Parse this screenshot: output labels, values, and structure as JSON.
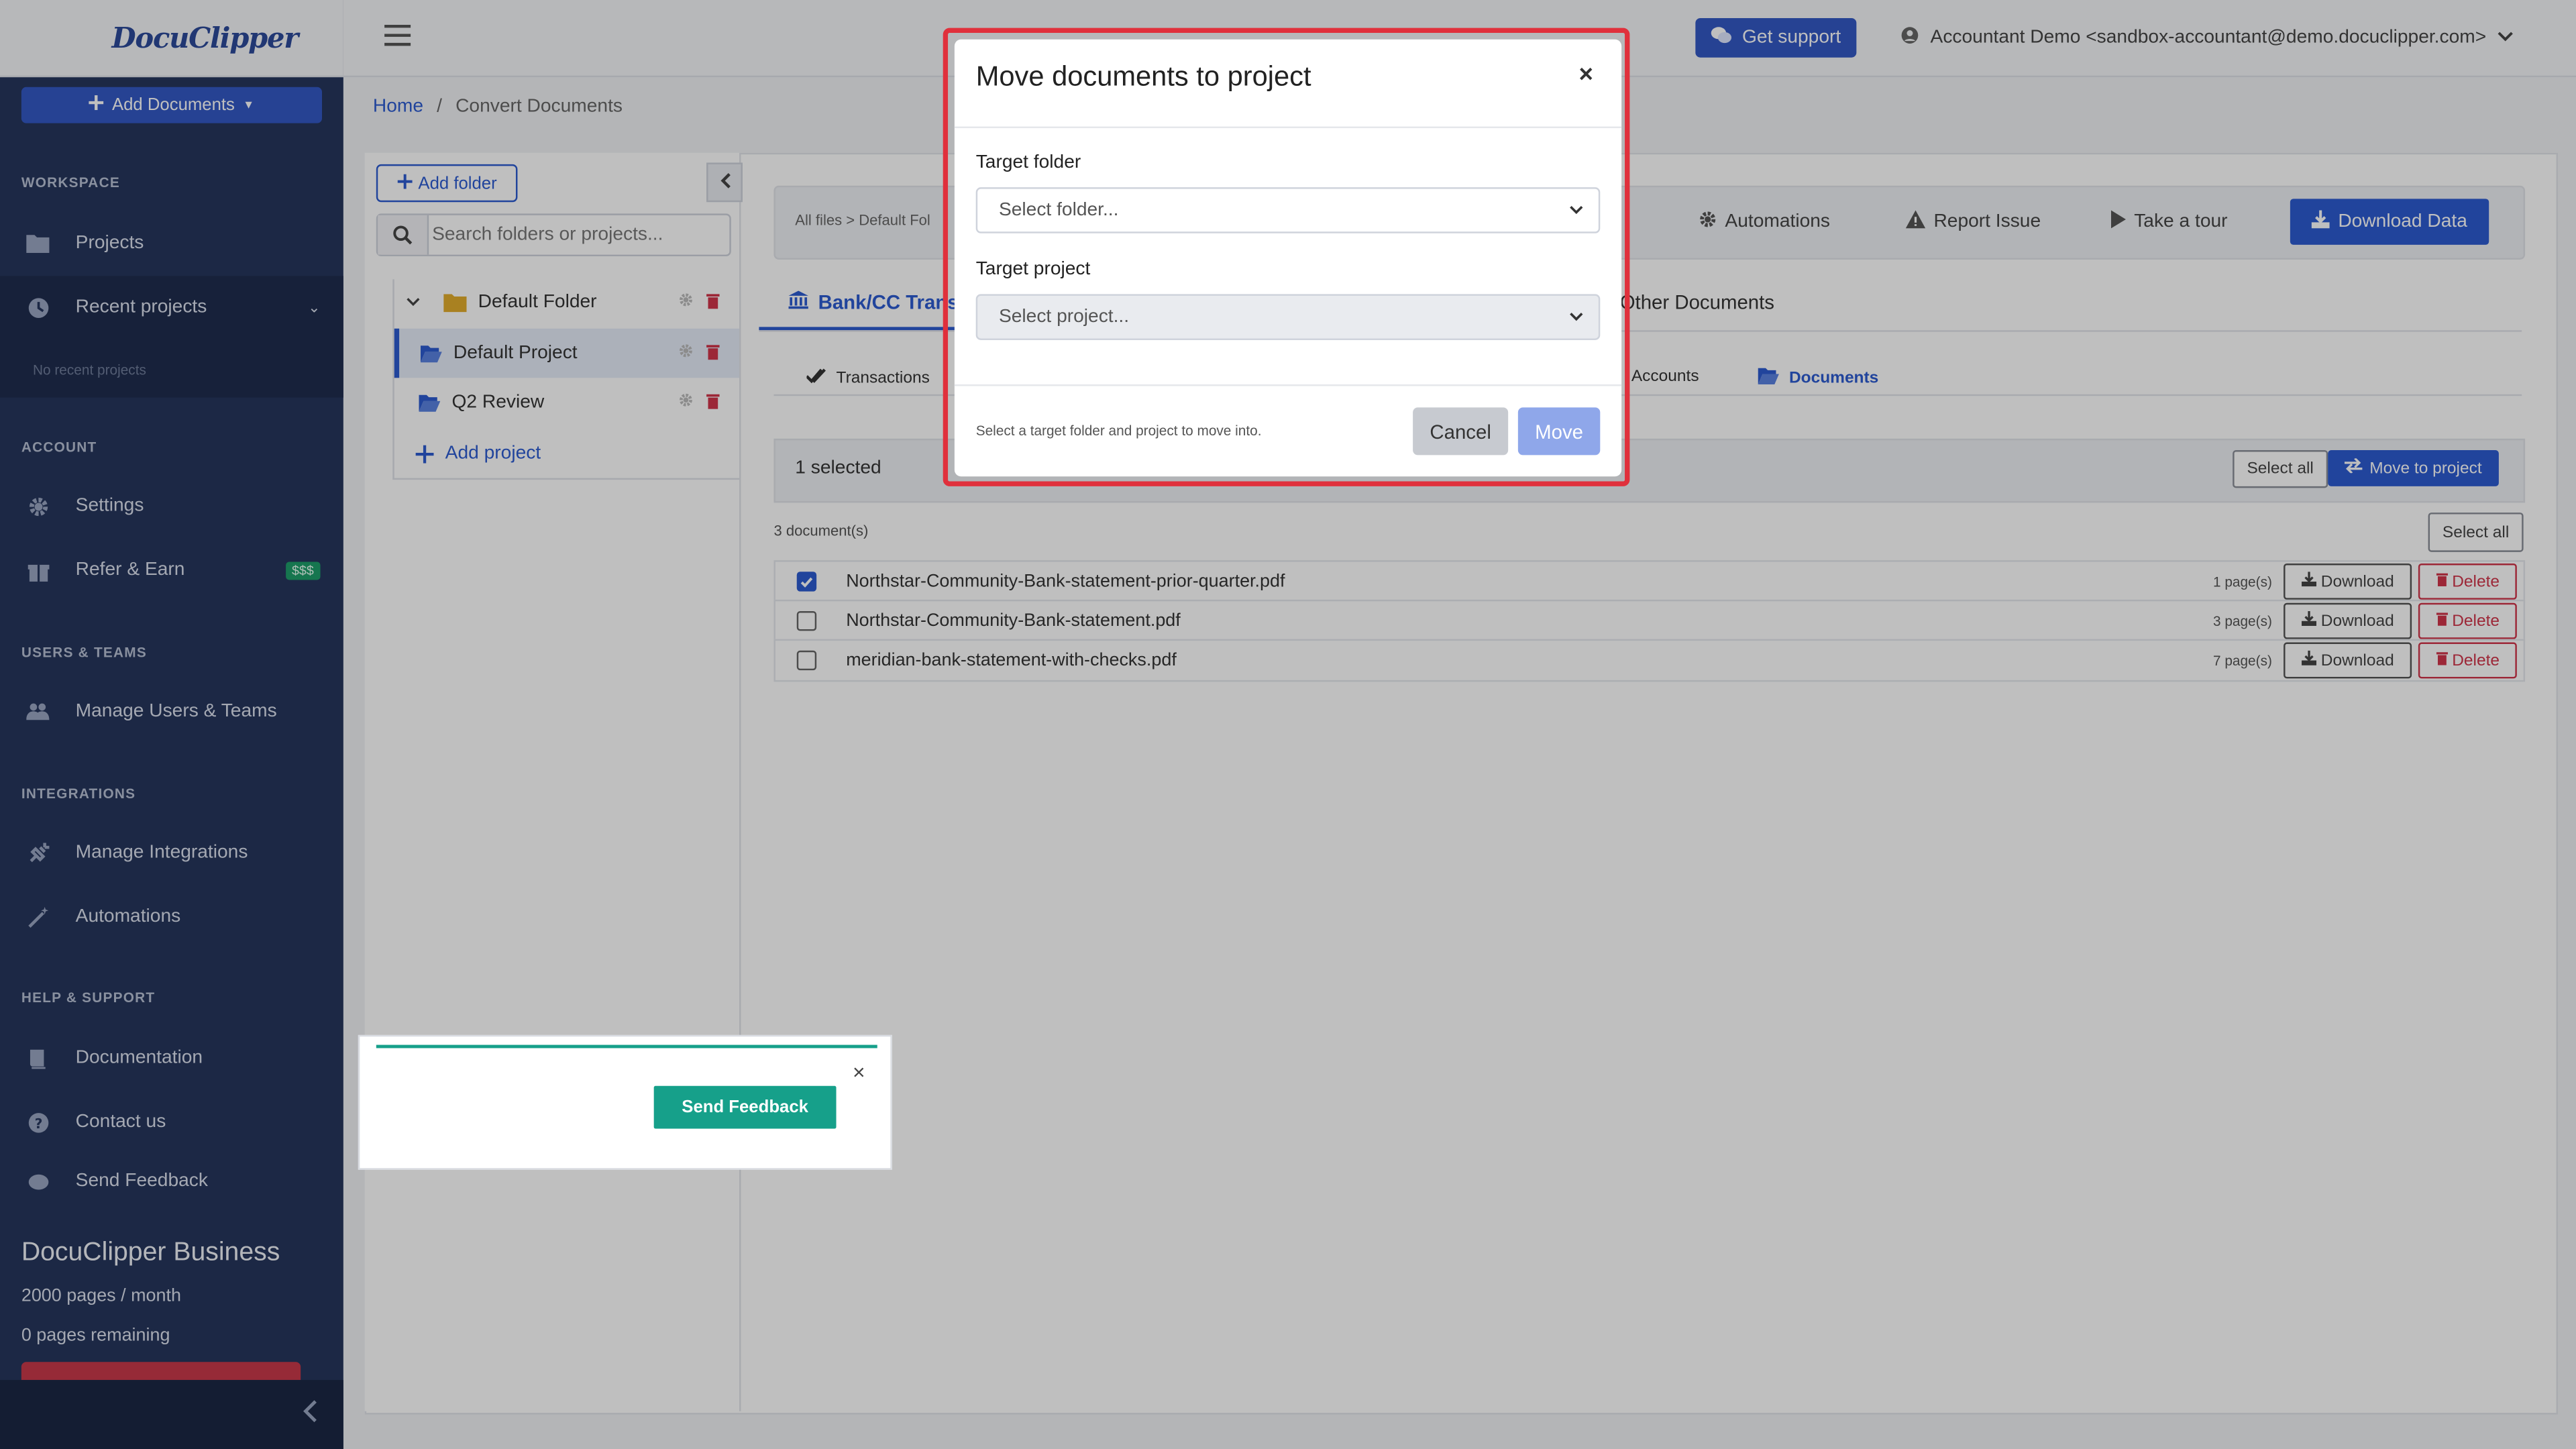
{
  "app": {
    "logo": "DocuClipper"
  },
  "sidebar": {
    "add_documents": "Add Documents",
    "sections": {
      "workspace": "WORKSPACE",
      "account": "ACCOUNT",
      "users_teams": "USERS & TEAMS",
      "integrations": "INTEGRATIONS",
      "help": "HELP & SUPPORT"
    },
    "items": {
      "projects": "Projects",
      "recent_projects": "Recent projects",
      "no_recent": "No recent projects",
      "settings": "Settings",
      "refer": "Refer & Earn",
      "refer_badge": "$$$",
      "manage_users": "Manage Users & Teams",
      "manage_integrations": "Manage Integrations",
      "automations": "Automations",
      "documentation": "Documentation",
      "contact": "Contact us",
      "send_feedback_partial": "Send Feedback"
    },
    "plan": {
      "title": "DocuClipper Business",
      "pages": "2000 pages / month",
      "remaining": "0 pages remaining"
    }
  },
  "topbar": {
    "get_support": "Get support",
    "user": "Accountant Demo <sandbox-accountant@demo.docuclipper.com>"
  },
  "breadcrumb": {
    "home": "Home",
    "sep": "/",
    "current": "Convert Documents"
  },
  "folders": {
    "add_folder": "Add folder",
    "search_placeholder": "Search folders or projects...",
    "tree": {
      "folder": "Default Folder",
      "project_selected": "Default Project",
      "project_other": "Q2 Review",
      "add_project": "Add project"
    }
  },
  "toolbar": {
    "mini_breadcrumb": "All files > Default Fol",
    "automations": "Automations",
    "report_issue": "Report Issue",
    "take_tour": "Take a tour",
    "download_data": "Download Data"
  },
  "tabs": {
    "bank": "Bank/CC Trans",
    "other": "Other Documents"
  },
  "subtabs": {
    "transactions": "Transactions",
    "accounts": "Accounts",
    "documents": "Documents"
  },
  "selection": {
    "count": "1 selected",
    "select_all": "Select all",
    "move_to_project": "Move to project",
    "doc_count": "3 document(s)",
    "select_all_2": "Select all"
  },
  "documents": [
    {
      "name": "Northstar-Community-Bank-statement-prior-quarter.pdf",
      "pages": "1 page(s)",
      "checked": true
    },
    {
      "name": "Northstar-Community-Bank-statement.pdf",
      "pages": "3 page(s)",
      "checked": false
    },
    {
      "name": "meridian-bank-statement-with-checks.pdf",
      "pages": "7 page(s)",
      "checked": false
    }
  ],
  "row_actions": {
    "download": "Download",
    "delete": "Delete"
  },
  "modal": {
    "title": "Move documents to project",
    "close": "×",
    "folder_label": "Target folder",
    "folder_placeholder": "Select folder...",
    "project_label": "Target project",
    "project_placeholder": "Select project...",
    "hint": "Select a target folder and project to move into.",
    "cancel": "Cancel",
    "move": "Move"
  },
  "feedback": {
    "close": "×",
    "button": "Send Feedback"
  },
  "colors": {
    "primary": "#2c5bd0",
    "sidebar": "#26365c",
    "danger": "#d0344a",
    "teal": "#16a08a",
    "highlight": "#e0303c"
  }
}
